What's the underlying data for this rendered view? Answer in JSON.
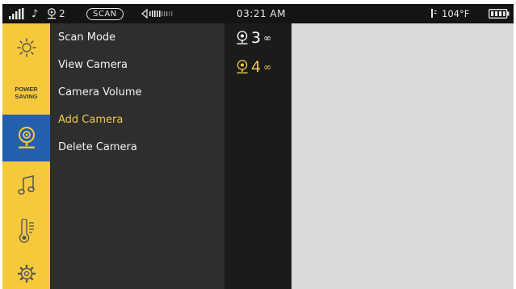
{
  "status_bar": {
    "camera_count": "2",
    "scan_label": "SCAN",
    "time": "03:21 AM",
    "temperature": "104°F"
  },
  "sidebar": {
    "items": [
      {
        "icon": "brightness-icon"
      },
      {
        "icon": "power-saving-icon",
        "label_line1": "POWER",
        "label_line2": "SAVING"
      },
      {
        "icon": "camera-icon",
        "active": true
      },
      {
        "icon": "music-note-icon"
      },
      {
        "icon": "thermometer-icon"
      },
      {
        "icon": "settings-gear-icon"
      }
    ]
  },
  "menu": {
    "items": [
      {
        "label": "Scan Mode"
      },
      {
        "label": "View Camera"
      },
      {
        "label": "Camera Volume"
      },
      {
        "label": "Add Camera",
        "highlighted": true
      },
      {
        "label": "Delete Camera"
      }
    ]
  },
  "camera_list": [
    {
      "number": "3",
      "color": "#ffffff"
    },
    {
      "number": "4",
      "color": "#f2c94c"
    }
  ],
  "colors": {
    "sidebar": "#f6c93d",
    "active_sidebar": "#2460ad",
    "highlight_text": "#f2c94c",
    "panel": "#2e2e2e",
    "status_bar": "#141414",
    "content": "#d9d9d9"
  }
}
